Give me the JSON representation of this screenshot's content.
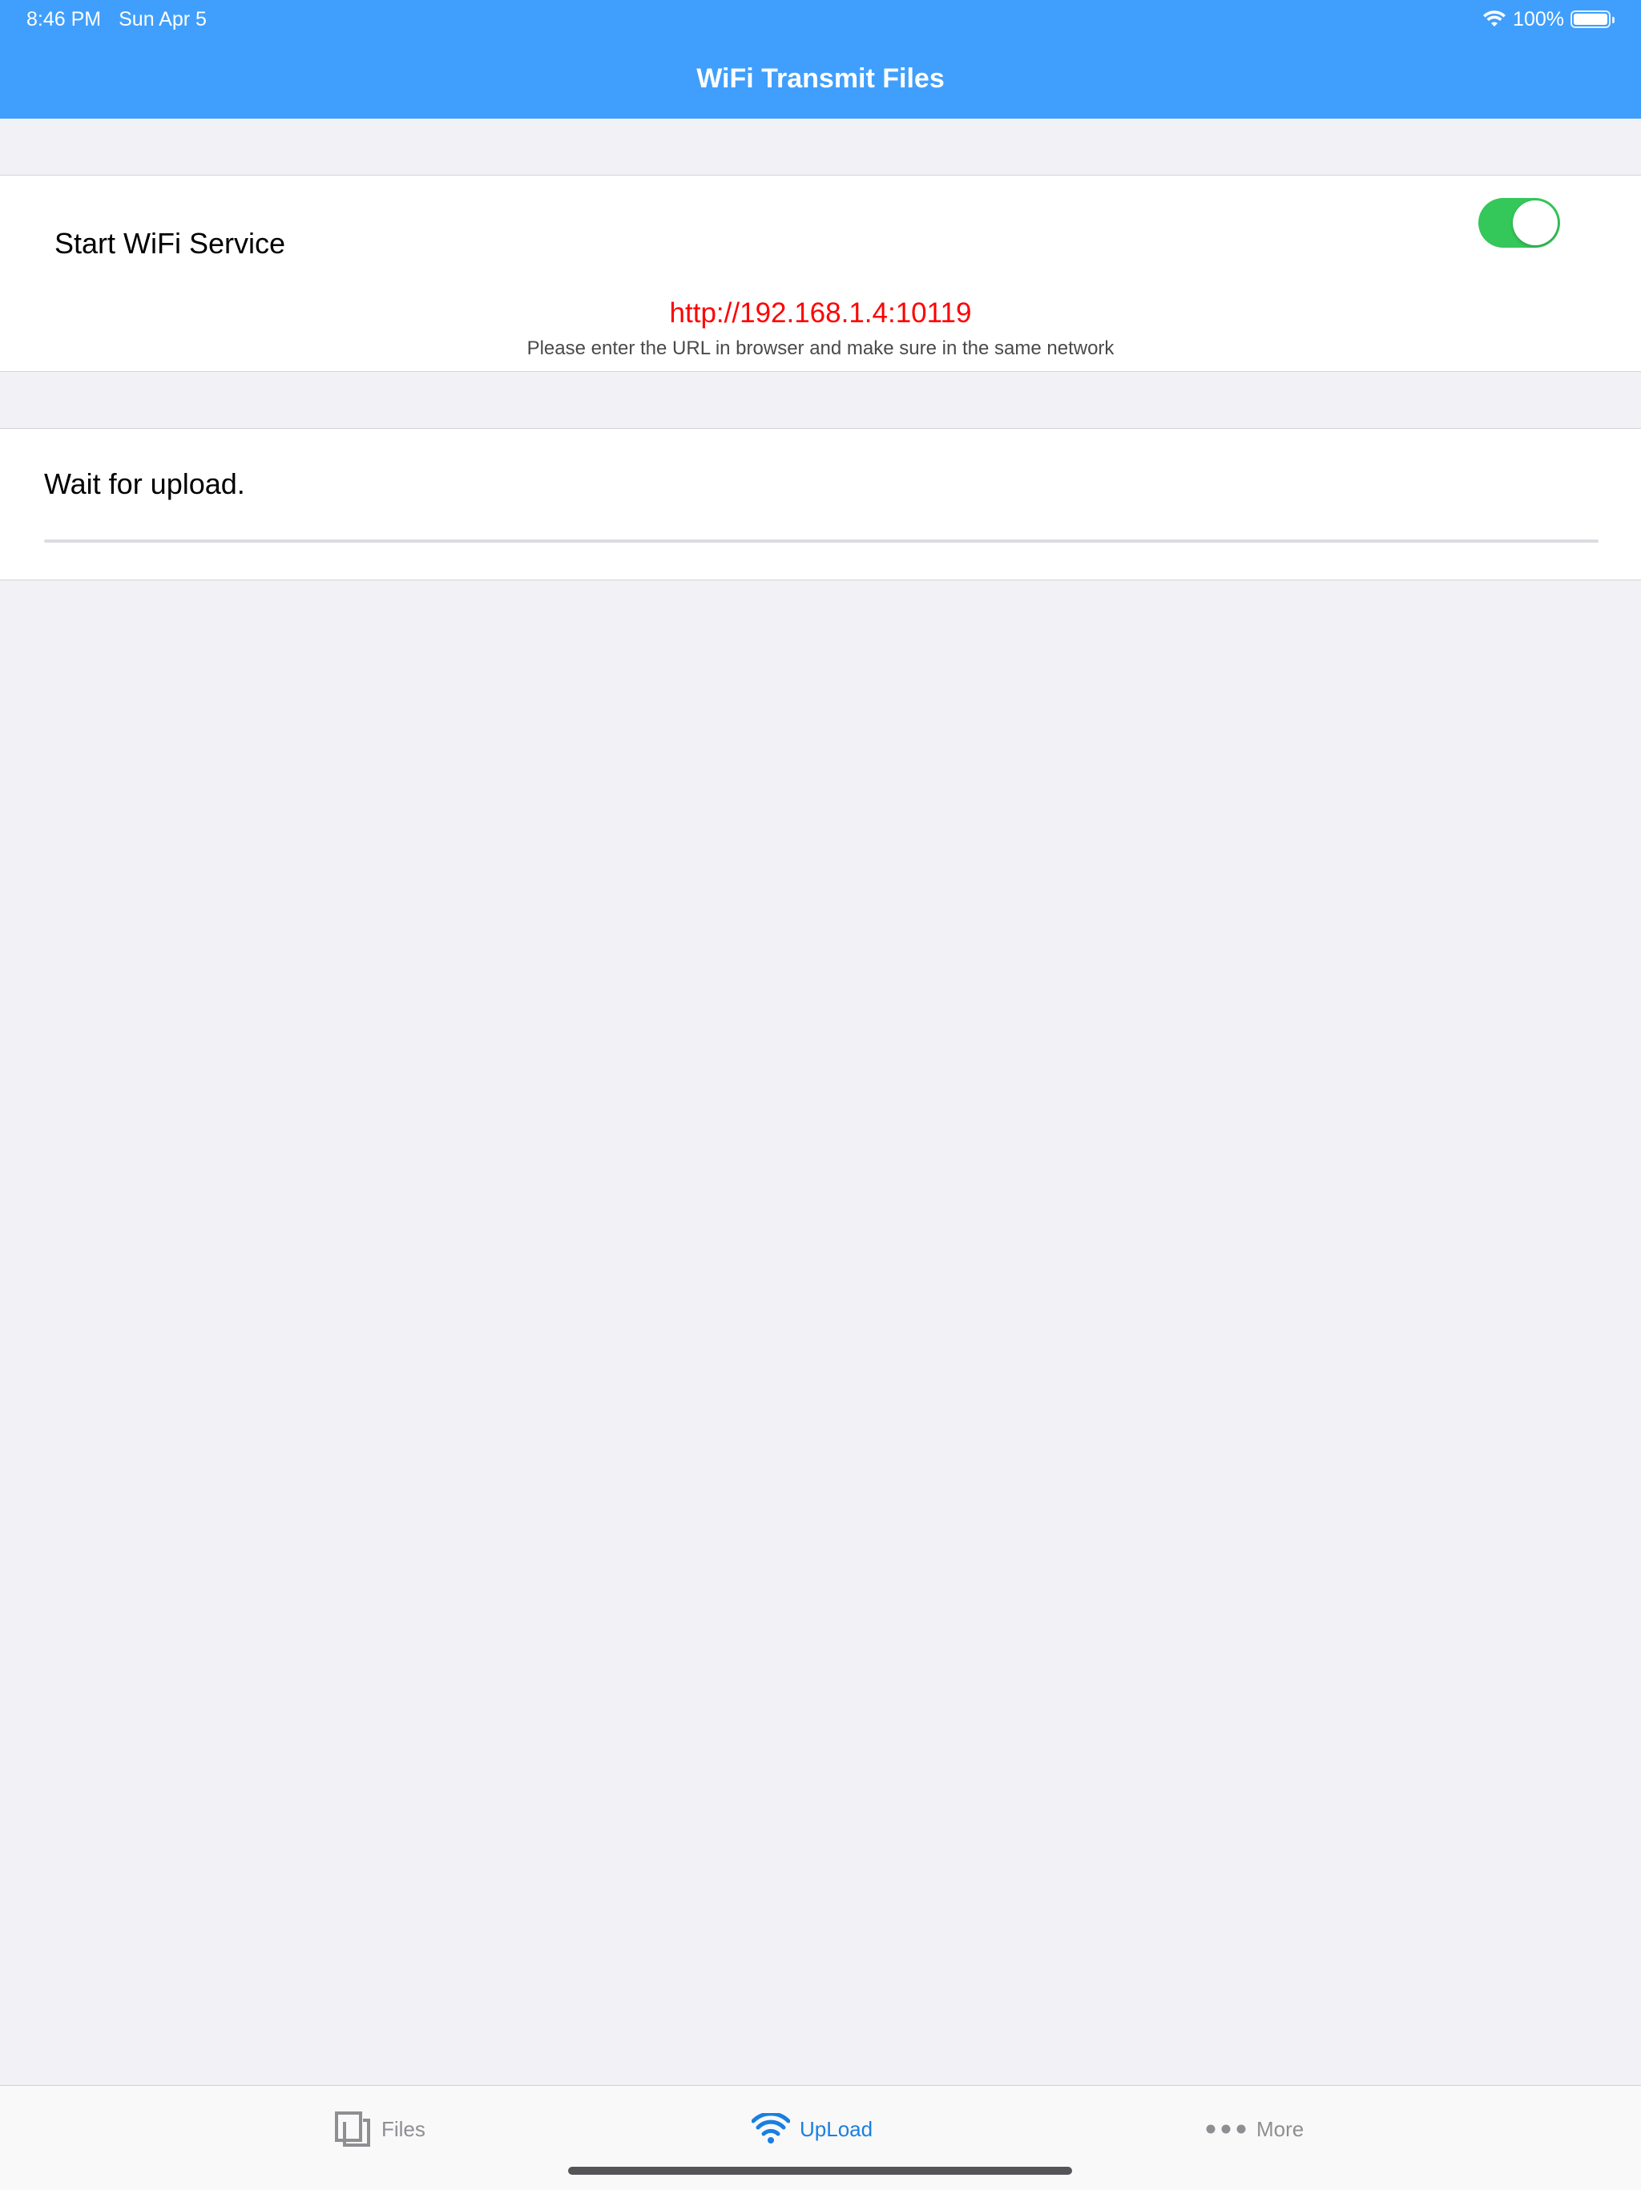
{
  "status_bar": {
    "time": "8:46 PM",
    "date": "Sun Apr 5",
    "battery_text": "100%",
    "battery_level": 1.0
  },
  "navigation": {
    "title": "WiFi Transmit Files"
  },
  "wifi_service": {
    "label": "Start WiFi Service",
    "toggle_on": true,
    "url": "http://192.168.1.4:10119",
    "hint": "Please enter the URL in browser and make sure in the same network"
  },
  "upload": {
    "status": "Wait for upload.",
    "progress": 0
  },
  "tab_bar": {
    "items": [
      {
        "label": "Files",
        "icon": "files-icon",
        "active": false
      },
      {
        "label": "UpLoad",
        "icon": "wifi-icon",
        "active": true
      },
      {
        "label": "More",
        "icon": "more-icon",
        "active": false
      }
    ]
  },
  "colors": {
    "accent": "#409ffc",
    "active_tab": "#1a7fe0",
    "url_text": "#fe0000",
    "toggle_on": "#34c759",
    "background": "#f1f1f6"
  }
}
